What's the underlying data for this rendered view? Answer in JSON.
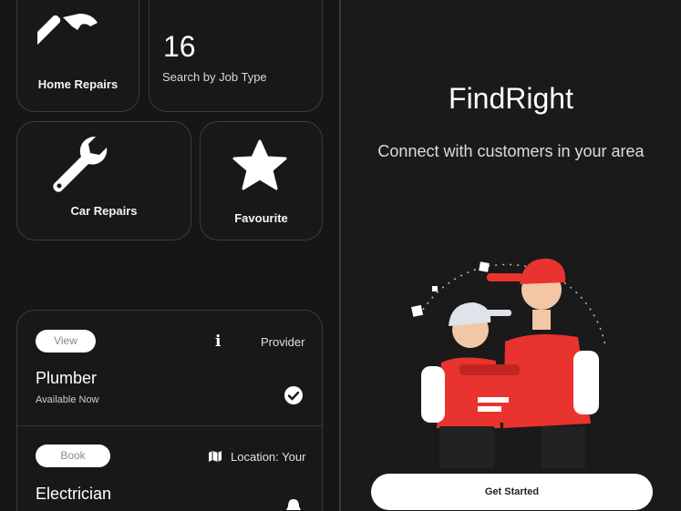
{
  "left": {
    "categories": {
      "home_repairs": {
        "label": "Home Repairs",
        "icon": "hammer-icon"
      },
      "job_types": {
        "count": "16",
        "label": "Search by Job Type"
      },
      "car_repairs": {
        "label": "Car Repairs",
        "icon": "wrench-icon"
      },
      "favourite": {
        "label": "Favourite",
        "icon": "star-icon"
      }
    },
    "jobs": [
      {
        "action_label": "View",
        "meta_label": "Provider",
        "meta_icon": "info-icon",
        "title": "Plumber",
        "subtitle": "Available Now",
        "status_icon": "check-circle-icon"
      },
      {
        "action_label": "Book",
        "meta_label": "Location: Your",
        "meta_icon": "map-icon",
        "title": "Electrician",
        "subtitle": "",
        "status_icon": "bell-icon"
      }
    ]
  },
  "right": {
    "brand": "FindRight",
    "tagline": "Connect with customers in your area",
    "cta_label": "Get Started"
  },
  "colors": {
    "background": "#161616",
    "card_border": "#3c3c3c",
    "accent_red": "#e8332f",
    "button_bg": "#ffffff"
  }
}
